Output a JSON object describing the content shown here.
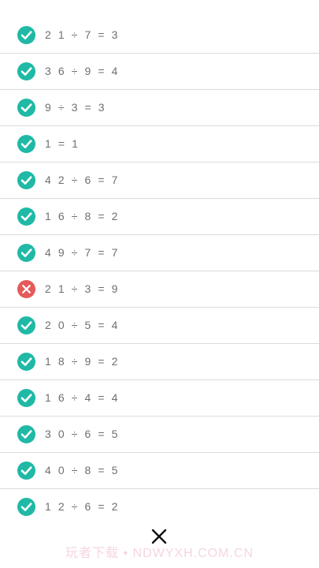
{
  "results": [
    {
      "equation": "2 1 ÷ 7 = 3",
      "status": "correct",
      "icon": "check-circle-icon"
    },
    {
      "equation": "3 6 ÷ 9 = 4",
      "status": "correct",
      "icon": "check-circle-icon"
    },
    {
      "equation": "9 ÷ 3 = 3",
      "status": "correct",
      "icon": "check-circle-icon"
    },
    {
      "equation": "1 = 1",
      "status": "correct",
      "icon": "check-circle-icon"
    },
    {
      "equation": "4 2 ÷ 6 = 7",
      "status": "correct",
      "icon": "check-circle-icon"
    },
    {
      "equation": "1 6 ÷ 8 = 2",
      "status": "correct",
      "icon": "check-circle-icon"
    },
    {
      "equation": "4 9 ÷ 7 = 7",
      "status": "correct",
      "icon": "check-circle-icon"
    },
    {
      "equation": "2 1 ÷ 3 = 9",
      "status": "wrong",
      "icon": "x-circle-icon"
    },
    {
      "equation": "2 0 ÷ 5 = 4",
      "status": "correct",
      "icon": "check-circle-icon"
    },
    {
      "equation": "1 8 ÷ 9 = 2",
      "status": "correct",
      "icon": "check-circle-icon"
    },
    {
      "equation": "1 6 ÷ 4 = 4",
      "status": "correct",
      "icon": "check-circle-icon"
    },
    {
      "equation": "3 0 ÷ 6 = 5",
      "status": "correct",
      "icon": "check-circle-icon"
    },
    {
      "equation": "4 0 ÷ 8 = 5",
      "status": "correct",
      "icon": "check-circle-icon"
    },
    {
      "equation": "1 2 ÷ 6 = 2",
      "status": "correct",
      "icon": "check-circle-icon"
    }
  ],
  "colors": {
    "correct": "#1fb9a6",
    "wrong": "#e55a5a",
    "text": "#6f6f6f",
    "divider": "#dcdcdc"
  },
  "close_icon": "close-icon",
  "watermark": "玩者下载 • NDWYXH.COM.CN"
}
